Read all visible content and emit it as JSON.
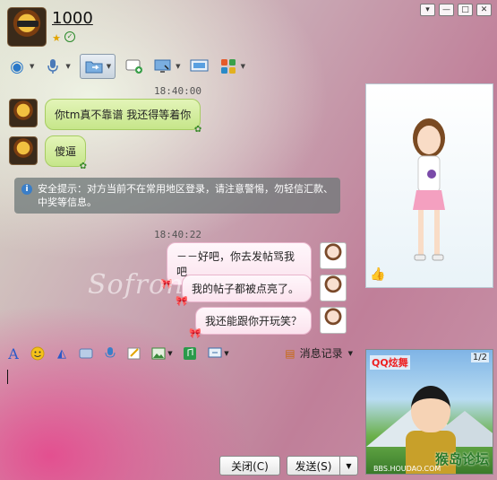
{
  "header": {
    "contact_name": "1000"
  },
  "window_controls": {
    "menu_glyph": "▾",
    "minimize_glyph": "—",
    "maximize_glyph": "□",
    "close_glyph": "✕"
  },
  "toolbar": {
    "items": [
      {
        "icon": "video-icon",
        "glyph": "◉",
        "color": "#2a78c8"
      },
      {
        "icon": "microphone-icon",
        "glyph": "🎙",
        "color": "#3a6aa8"
      },
      {
        "icon": "file-transfer-icon",
        "glyph": "📁",
        "color": "#4a8ac8"
      },
      {
        "icon": "sms-icon",
        "glyph": "✉",
        "color": "#3a9a4a"
      },
      {
        "icon": "remote-desktop-icon",
        "glyph": "🖥",
        "color": "#3a7ac8"
      },
      {
        "icon": "screen-share-icon",
        "glyph": "⎚",
        "color": "#2a8ac8"
      },
      {
        "icon": "apps-icon",
        "glyph": "▦",
        "color": "#d0602a"
      }
    ]
  },
  "messages": {
    "ts1": "18:40:00",
    "m1": "你tm真不靠谱 我还得等着你",
    "m2": "傻逼",
    "security_notice": "安全提示：对方当前不在常用地区登录，请注意警惕，勿轻信汇款、中奖等信息。",
    "ts2": "18:40:22",
    "m3": "－－好吧，你去发帖骂我吧",
    "m4": "我的帖子都被点亮了。",
    "m5": "我还能跟你开玩笑？"
  },
  "watermark": "Sofron",
  "input_toolbar": {
    "history_label": "消息记录"
  },
  "ad": {
    "page": "1/2",
    "logo": "QQ炫舞",
    "watermark": "猴岛论坛",
    "watermark_url": "BBS.HOUDAO.COM"
  },
  "buttons": {
    "close": "关闭(C)",
    "send": "发送(S)"
  }
}
